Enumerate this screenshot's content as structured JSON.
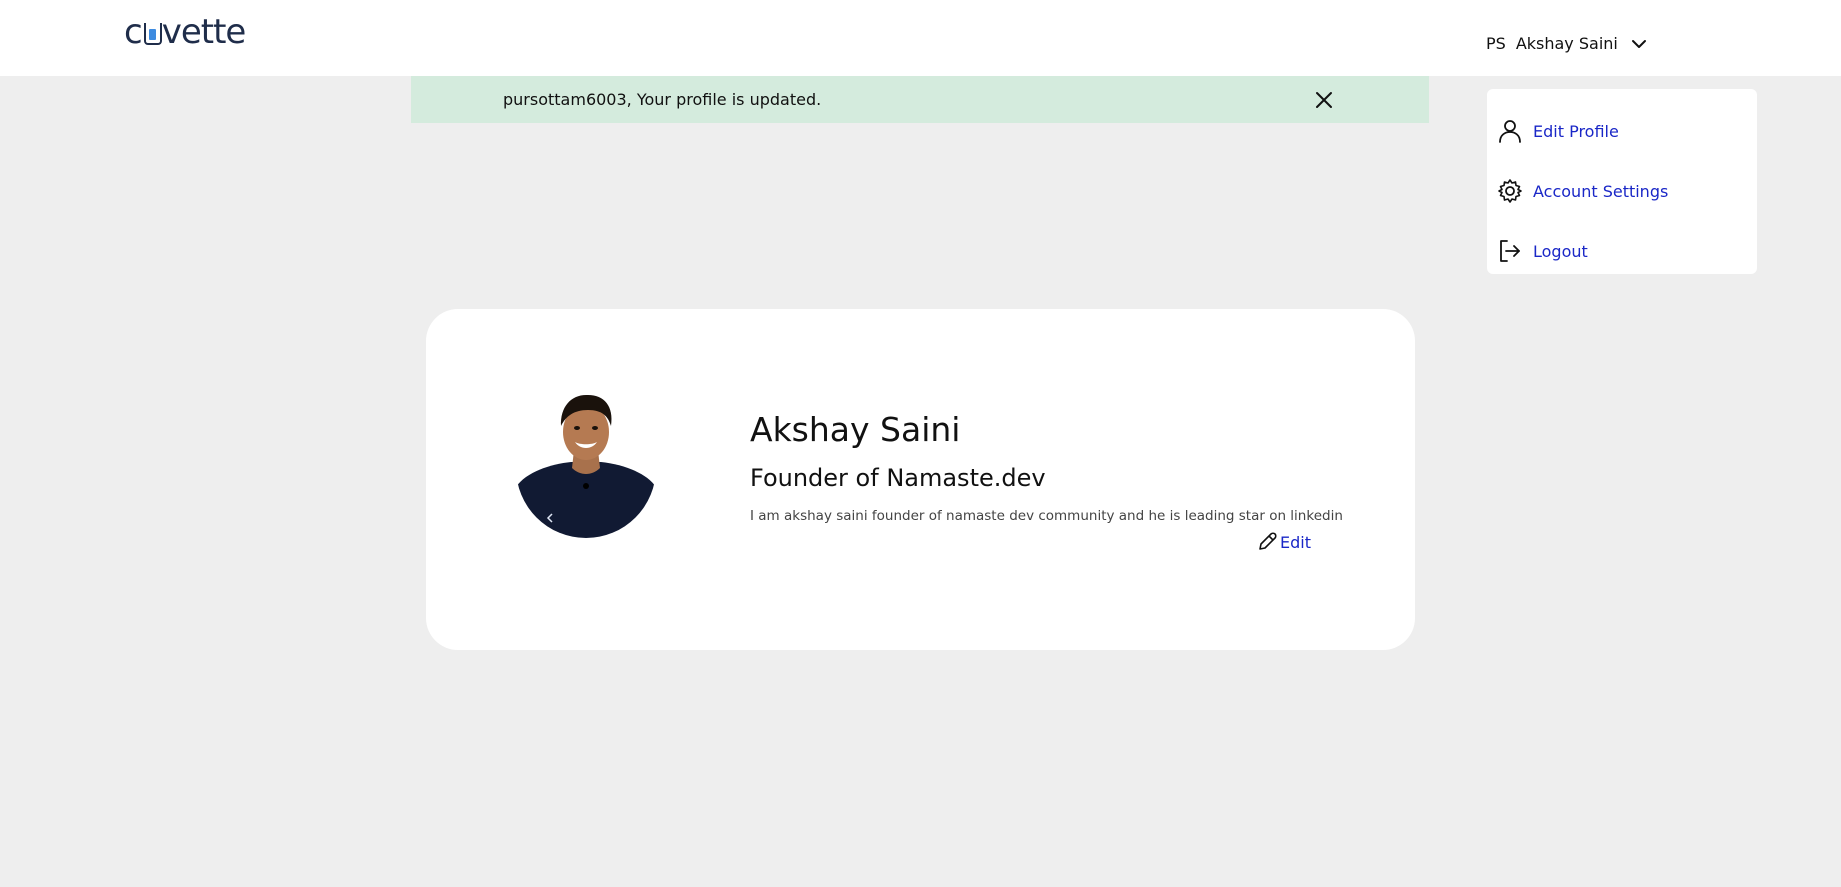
{
  "header": {
    "logo_left": "c",
    "logo_right": "vette",
    "user_initials": "PS",
    "user_name": "Akshay Saini"
  },
  "toast": {
    "message": "pursottam6003, Your profile is updated."
  },
  "dropdown": {
    "items": [
      {
        "label": "Edit Profile",
        "icon": "user-icon"
      },
      {
        "label": "Account Settings",
        "icon": "gear-icon"
      },
      {
        "label": "Logout",
        "icon": "logout-icon"
      }
    ]
  },
  "profile": {
    "name": "Akshay Saini",
    "title": "Founder of Namaste.dev",
    "bio": "I am akshay saini founder of namaste dev community and he is leading star on linkedin",
    "edit_label": "Edit"
  },
  "colors": {
    "link": "#1a27c7",
    "toast_bg": "#d4ebdd",
    "page_bg": "#eeeeee"
  }
}
